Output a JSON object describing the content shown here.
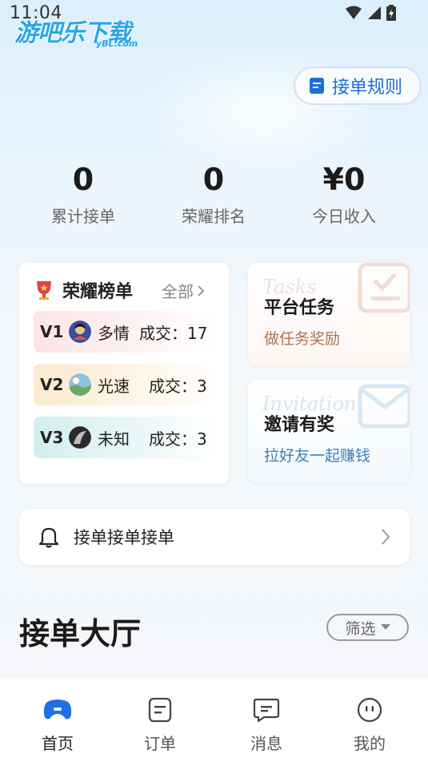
{
  "status_bar": {
    "time": "11:04"
  },
  "watermark": {
    "main": "游吧乐下载",
    "sub": "yBL.com"
  },
  "header": {
    "rules_label": "接单规则"
  },
  "stats": [
    {
      "value": "0",
      "label": "累计接单"
    },
    {
      "value": "0",
      "label": "荣耀排名"
    },
    {
      "value": "¥0",
      "label": "今日收入"
    }
  ],
  "honor": {
    "title": "荣耀榜单",
    "all_label": "全部",
    "rows": [
      {
        "level": "V1",
        "name": "多情",
        "deal": "成交：17"
      },
      {
        "level": "V2",
        "name": "光速",
        "deal": "成交：3"
      },
      {
        "level": "V3",
        "name": "未知",
        "deal": "成交：3"
      }
    ]
  },
  "task_card": {
    "script": "Tasks",
    "title": "平台任务",
    "subtitle": "做任务奖励"
  },
  "invite_card": {
    "script": "Invitation",
    "title": "邀请有奖",
    "subtitle": "拉好友一起赚钱"
  },
  "notice": {
    "text": "接单接单接单"
  },
  "hall": {
    "title": "接单大厅",
    "filter_label": "筛选"
  },
  "tabs": [
    {
      "label": "首页",
      "active": true
    },
    {
      "label": "订单",
      "active": false
    },
    {
      "label": "消息",
      "active": false
    },
    {
      "label": "我的",
      "active": false
    }
  ],
  "colors": {
    "accent": "#1d6fd6",
    "active_tab": "#1f6fe8",
    "rank_red": "#e0453a"
  }
}
